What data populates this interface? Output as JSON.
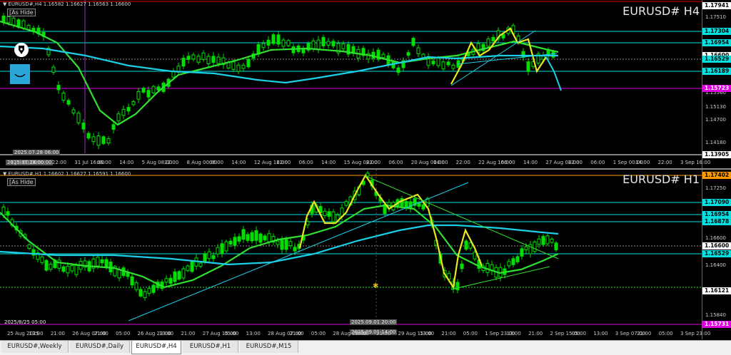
{
  "colors": {
    "background": "#000000",
    "candle": "#00e000",
    "ma_fast": "#30e030",
    "ma_slow": "#1ccfe8",
    "zigzag": "#e8e820",
    "hline": "#00e0e0",
    "magenta": "#e000e0",
    "orange": "#ff9900",
    "trend": "#1ccfe8"
  },
  "icons": {
    "pen": "fountain-pen-icon",
    "smile": "smile-box-icon"
  },
  "top": {
    "info": "EURUSD#,H4  1.16582 1.16627 1.16563 1.16600",
    "symbol": "EURUSD# H4",
    "ashide": "[As Hide",
    "timestamp_label": "2025.07.28 06:00",
    "bottom_timestamp": "2025.07.28 00:00",
    "price_ticks": [
      "1.17941",
      "1.17510",
      "1.17030",
      "1.16600",
      "1.16170",
      "1.15560",
      "1.15130",
      "1.14700",
      "1.14180",
      "1.13905"
    ],
    "price_tags": [
      {
        "label": "1.17941",
        "bg": "#ffffff",
        "fg": "#000000"
      },
      {
        "label": "1.17304",
        "bg": "#00e0e0",
        "fg": "#000000"
      },
      {
        "label": "1.16954",
        "bg": "#00e0e0",
        "fg": "#000000"
      },
      {
        "label": "1.16600",
        "bg": "#ffffff",
        "fg": "#000000"
      },
      {
        "label": "1.16529",
        "bg": "#00e0e0",
        "fg": "#000000"
      },
      {
        "label": "1.16189",
        "bg": "#00e0e0",
        "fg": "#000000"
      },
      {
        "label": "1.15723",
        "bg": "#e000e0",
        "fg": "#ffffff"
      },
      {
        "label": "1.13905",
        "bg": "#ffffff",
        "fg": "#000000"
      }
    ],
    "time_ticks": [
      "24 Jul 00:00",
      "14:00",
      "22:00",
      "31 Jul 16:00",
      "06:00",
      "14:00",
      "5 Aug 08:00",
      "22:00",
      "8 Aug 00:00",
      "06:00",
      "14:00",
      "12 Aug 16:00",
      "22:00",
      "06:00",
      "14:00",
      "15 Aug 08:00",
      "22:00",
      "06:00",
      "20 Aug 00:00",
      "14:00",
      "22:00",
      "22 Aug 16:00",
      "06:00",
      "14:00",
      "27 Aug 08:00",
      "22:00",
      "06:00",
      "1 Sep 00:00",
      "14:00",
      "22:00",
      "3 Sep 16:00"
    ]
  },
  "bottom": {
    "info": "EURUSD#,H1  1.16602 1.16627 1.16591 1.16600",
    "symbol": "EURUSD# H1",
    "ashide": "[As Hide",
    "timestamp_label": "2025.09.01 20:00",
    "bottom_timestamp": "2025.09.01 14:00",
    "left_date": "2025/8/25 05:00",
    "price_ticks": [
      "1.17402",
      "1.17250",
      "1.16600",
      "1.16400",
      "1.16121",
      "1.15840",
      "1.15731"
    ],
    "price_tags": [
      {
        "label": "1.17402",
        "bg": "#ff9900",
        "fg": "#000000"
      },
      {
        "label": "1.17090",
        "bg": "#00e0e0",
        "fg": "#000000"
      },
      {
        "label": "1.16954",
        "bg": "#00e0e0",
        "fg": "#000000"
      },
      {
        "label": "1.16878",
        "bg": "#00e0e0",
        "fg": "#000000"
      },
      {
        "label": "1.16600",
        "bg": "#ffffff",
        "fg": "#000000"
      },
      {
        "label": "1.16529",
        "bg": "#00e0e0",
        "fg": "#000000"
      },
      {
        "label": "1.16121",
        "bg": "#ffffff",
        "fg": "#000000"
      },
      {
        "label": "1.15731",
        "bg": "#e000e0",
        "fg": "#ffffff"
      }
    ],
    "time_ticks": [
      "25 Aug 2025",
      "13:00",
      "21:00",
      "26 Aug 07:00",
      "21:00",
      "05:00",
      "26 Aug 23:00",
      "13:00",
      "21:00",
      "27 Aug 15:00",
      "05:00",
      "13:00",
      "28 Aug 07:00",
      "21:00",
      "05:00",
      "28 Aug 23:00",
      "13:00",
      "21:00",
      "29 Aug 15:00",
      "13:00",
      "21:00",
      "05:00",
      "1 Sep 23:00",
      "13:00",
      "21:00",
      "2 Sep 15:00",
      "05:00",
      "13:00",
      "3 Sep 07:00",
      "21:00",
      "05:00",
      "3 Sep 23:00"
    ]
  },
  "tabs": [
    {
      "label": "EURUSD#,Weekly",
      "active": false
    },
    {
      "label": "EURUSD#,Daily",
      "active": false
    },
    {
      "label": "EURUSD#,H4",
      "active": true
    },
    {
      "label": "EURUSD#,H1",
      "active": false
    },
    {
      "label": "EURUSD#,M15",
      "active": false
    }
  ]
}
